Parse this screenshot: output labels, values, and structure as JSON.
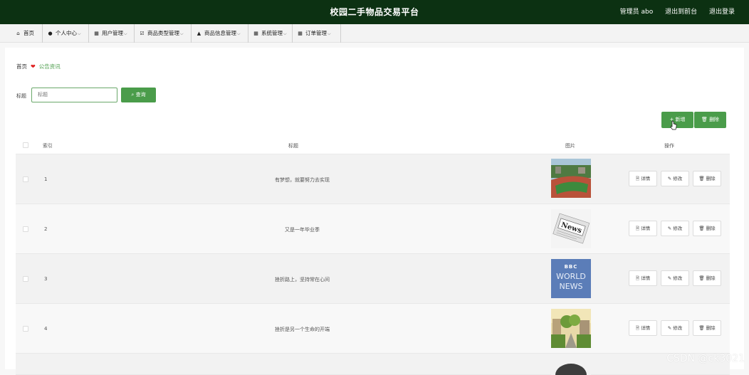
{
  "header": {
    "title": "校园二手物品交易平台",
    "user": "管理员 abo",
    "to_front": "退出到前台",
    "logout": "退出登录"
  },
  "nav": [
    {
      "label": "首页",
      "icon": "home-icon",
      "glyph": "⌂",
      "dropdown": false
    },
    {
      "label": "个人中心",
      "icon": "user-icon",
      "glyph": "●",
      "dropdown": true
    },
    {
      "label": "用户管理",
      "icon": "grid-icon",
      "glyph": "▦",
      "dropdown": true
    },
    {
      "label": "商品类型管理",
      "icon": "checkbox-icon",
      "glyph": "☑",
      "dropdown": true
    },
    {
      "label": "商品信息管理",
      "icon": "car-icon",
      "glyph": "▲",
      "dropdown": true
    },
    {
      "label": "系统管理",
      "icon": "grid-icon",
      "glyph": "▦",
      "dropdown": true
    },
    {
      "label": "订单管理",
      "icon": "grid-icon",
      "glyph": "▦",
      "dropdown": true
    }
  ],
  "breadcrumb": {
    "home": "首页",
    "current": "公告资讯"
  },
  "search": {
    "label": "标题",
    "placeholder": "标题",
    "button": "查询"
  },
  "actions": {
    "add": "新增",
    "delete": "删除"
  },
  "table": {
    "headers": {
      "index": "索引",
      "title": "标题",
      "image": "图片",
      "ops": "操作"
    },
    "op_labels": {
      "detail": "详情",
      "edit": "修改",
      "delete": "删除"
    },
    "rows": [
      {
        "index": "1",
        "title": "有梦想，就要努力去实现",
        "image": "track-field-photo"
      },
      {
        "index": "2",
        "title": "又是一年毕业季",
        "image": "news-paper-photo"
      },
      {
        "index": "3",
        "title": "挫折路上，坚持常在心间",
        "image": "bbc-world-news-logo"
      },
      {
        "index": "4",
        "title": "挫折是另一个生命的开端",
        "image": "campus-street-photo"
      }
    ]
  },
  "bbc_text": {
    "top": "BBC",
    "mid": "WORLD",
    "bot": "NEWS"
  },
  "news_text": "News",
  "watermark": "CSDN @ck3021",
  "colors": {
    "topbar": "#0c3112",
    "accent": "#4a9c4a",
    "heart": "#e02020"
  }
}
